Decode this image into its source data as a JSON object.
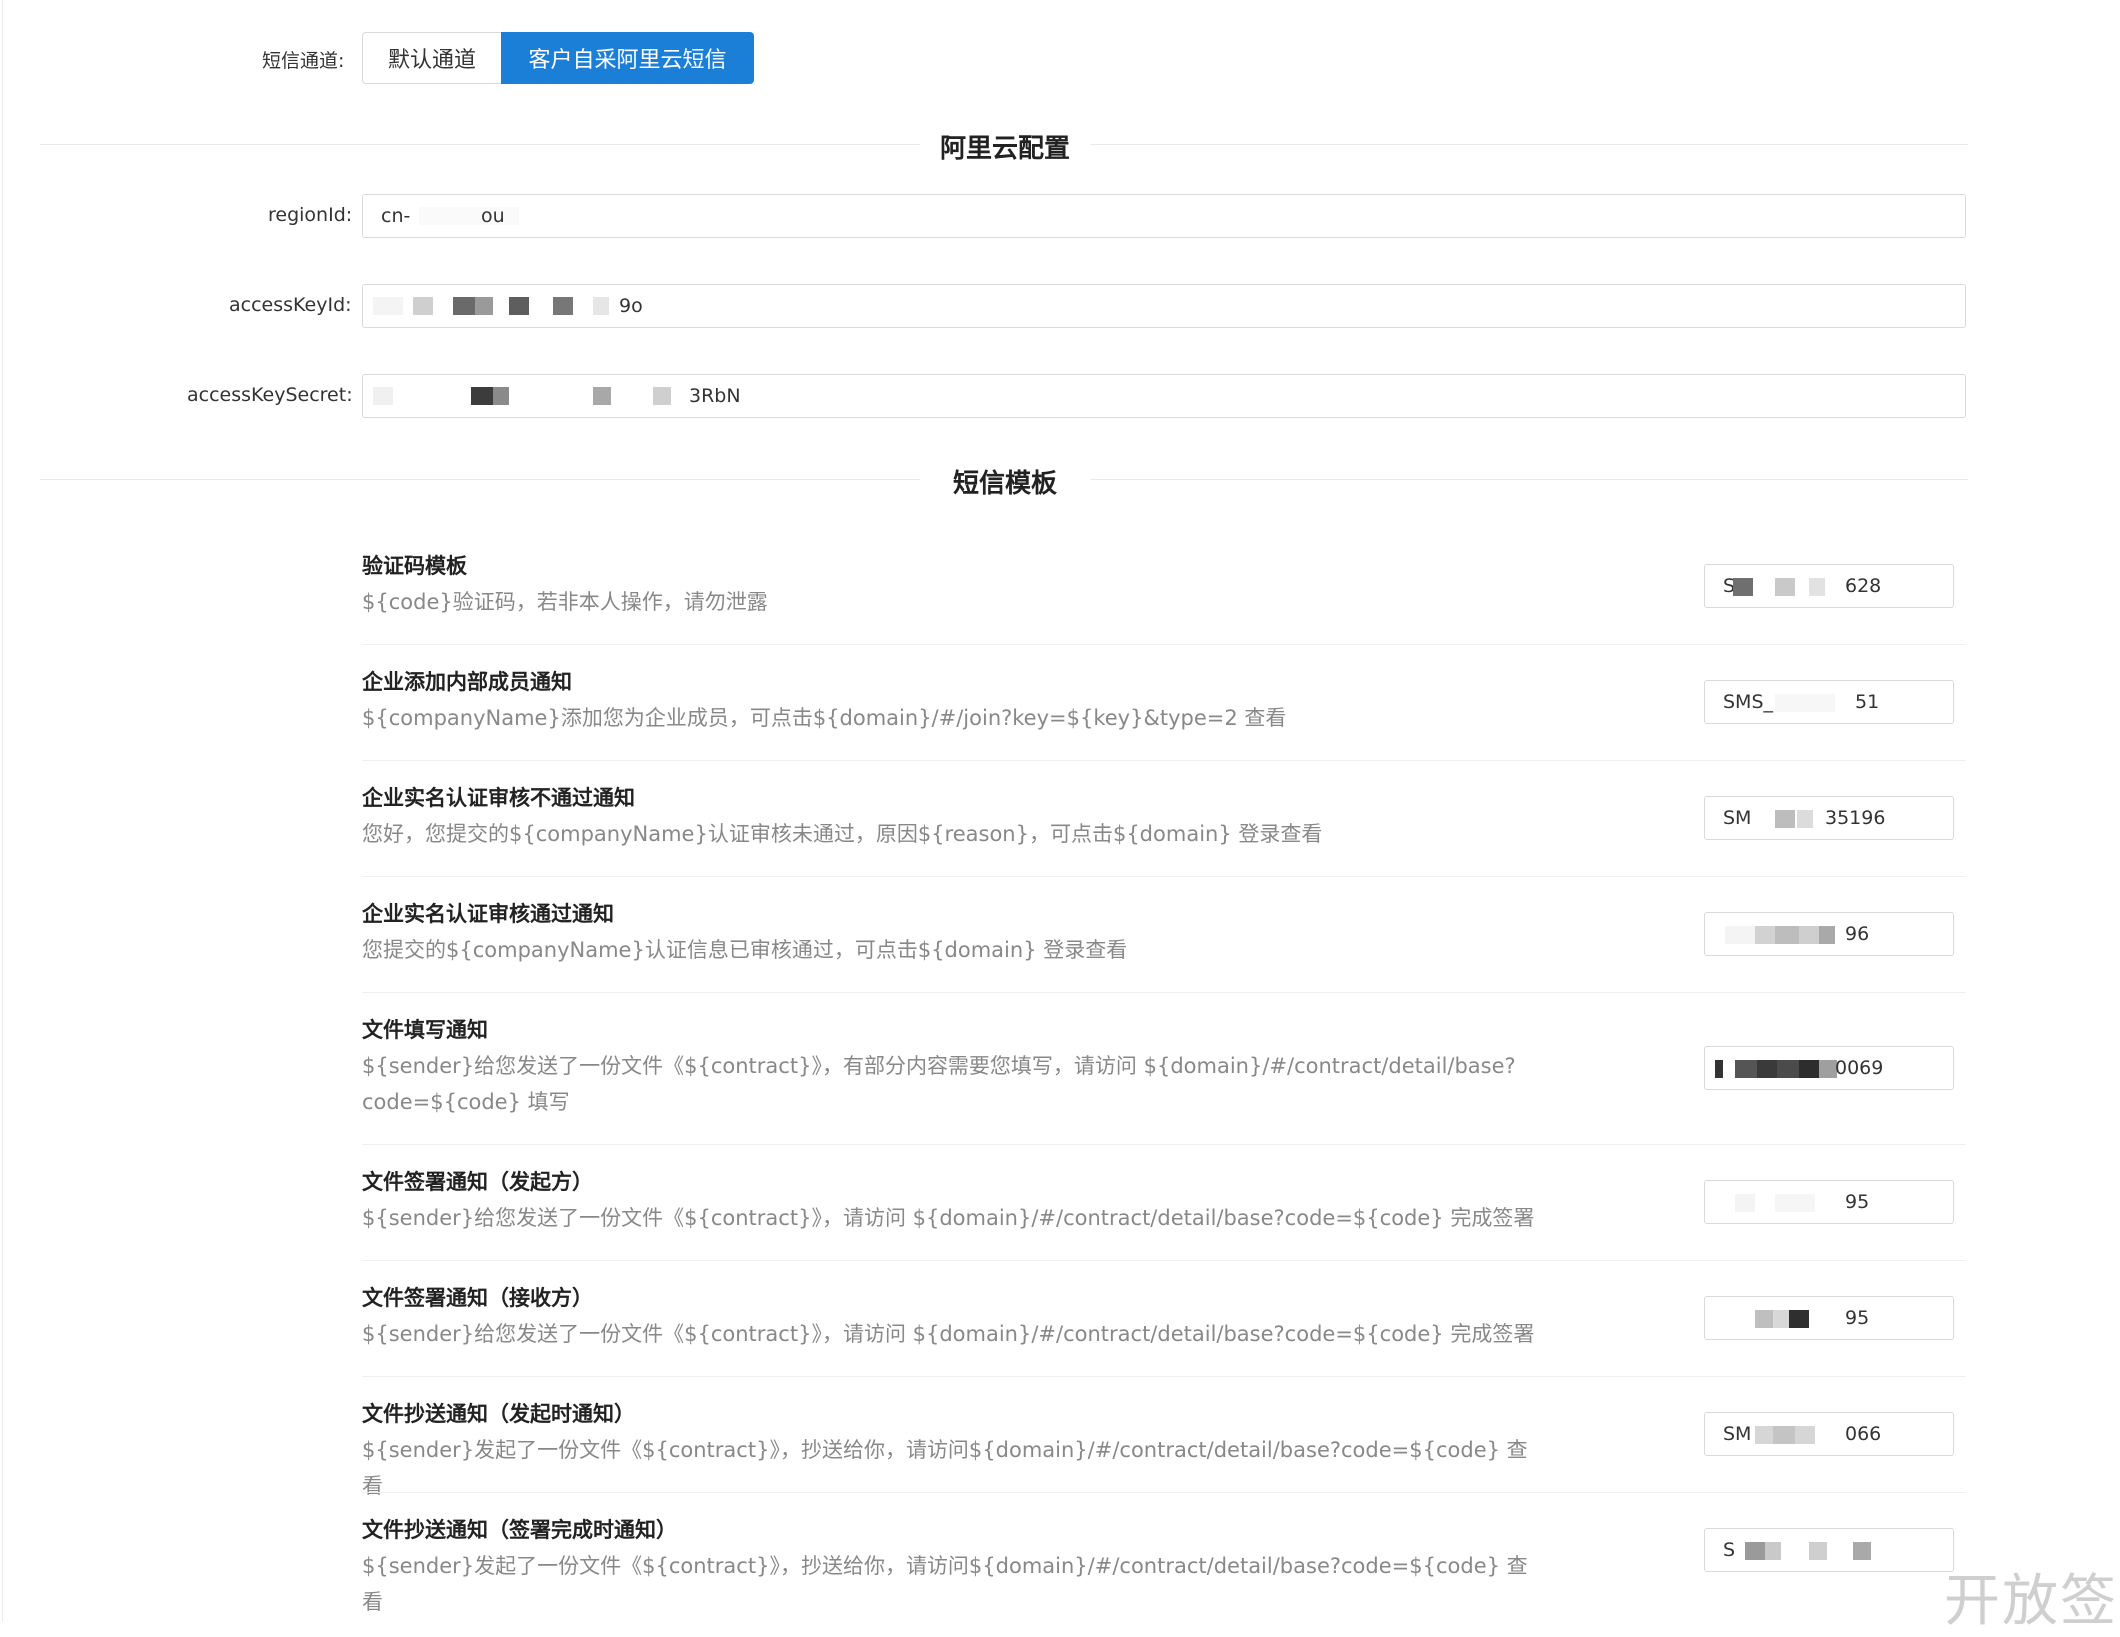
{
  "channel": {
    "label": "短信通道:",
    "options": [
      "默认通道",
      "客户自采阿里云短信"
    ],
    "selected": "客户自采阿里云短信"
  },
  "aliyun_section": {
    "title": "阿里云配置",
    "fields": [
      {
        "label": "regionId:",
        "prefix": "cn-",
        "suffix": "ou"
      },
      {
        "label": "accessKeyId:",
        "prefix": "",
        "suffix": "9o"
      },
      {
        "label": "accessKeySecret:",
        "prefix": "",
        "suffix": "3RbN"
      }
    ]
  },
  "template_section": {
    "title": "短信模板",
    "templates": [
      {
        "title": "验证码模板",
        "desc": "${code}验证码，若非本人操作，请勿泄露",
        "code_prefix": "S",
        "code_suffix": "628"
      },
      {
        "title": "企业添加内部成员通知",
        "desc": "${companyName}添加您为企业成员，可点击${domain}/#/join?key=${key}&type=2 查看",
        "code_prefix": "SMS_",
        "code_suffix": "51"
      },
      {
        "title": "企业实名认证审核不通过通知",
        "desc": "您好，您提交的${companyName}认证审核未通过，原因${reason}，可点击${domain} 登录查看",
        "code_prefix": "SM",
        "code_suffix": "35196"
      },
      {
        "title": "企业实名认证审核通过通知",
        "desc": "您提交的${companyName}认证信息已审核通过，可点击${domain} 登录查看",
        "code_prefix": "",
        "code_suffix": "96"
      },
      {
        "title": "文件填写通知",
        "desc": "${sender}给您发送了一份文件《${contract}》，有部分内容需要您填写，请访问 ${domain}/#/contract/detail/base?code=${code} 填写",
        "code_prefix": "",
        "code_suffix": "0069"
      },
      {
        "title": "文件签署通知（发起方）",
        "desc": "${sender}给您发送了一份文件《${contract}》，请访问 ${domain}/#/contract/detail/base?code=${code} 完成签署",
        "code_prefix": "",
        "code_suffix": "95"
      },
      {
        "title": "文件签署通知（接收方）",
        "desc": "${sender}给您发送了一份文件《${contract}》，请访问 ${domain}/#/contract/detail/base?code=${code} 完成签署",
        "code_prefix": "",
        "code_suffix": "95"
      },
      {
        "title": "文件抄送通知（发起时通知）",
        "desc": "${sender}发起了一份文件《${contract}》，抄送给你，请访问${domain}/#/contract/detail/base?code=${code} 查看",
        "code_prefix": "SM",
        "code_suffix": "066"
      },
      {
        "title": "文件抄送通知（签署完成时通知）",
        "desc": "${sender}发起了一份文件《${contract}》，抄送给你，请访问${domain}/#/contract/detail/base?code=${code} 查看",
        "code_prefix": "S",
        "code_suffix": ""
      }
    ]
  },
  "watermark": "开放签",
  "colors": {
    "accent": "#1b7fd8",
    "muted_text": "#888888",
    "border": "#d9d9d9"
  }
}
